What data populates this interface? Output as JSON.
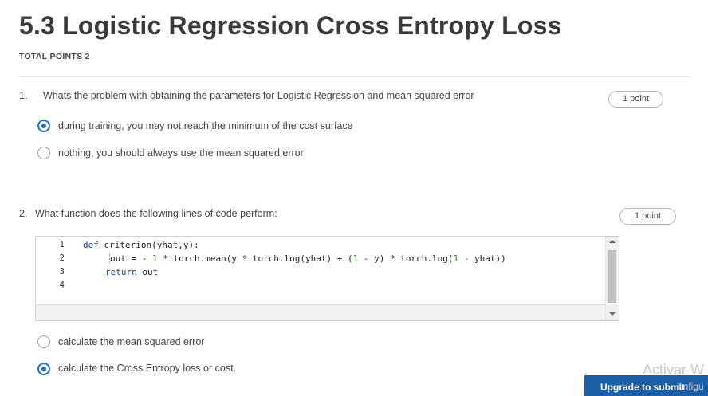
{
  "header": {
    "title": "5.3 Logistic Regression Cross Entropy Loss",
    "total_points": "TOTAL POINTS 2"
  },
  "questions": [
    {
      "number": "1.",
      "text": "Whats the problem with obtaining the parameters for Logistic Regression and mean squared error",
      "points": "1 point",
      "options": [
        {
          "label": "during training, you may not reach the minimum of the cost surface",
          "selected": true
        },
        {
          "label": "nothing, you should always use the mean squared error",
          "selected": false
        }
      ]
    },
    {
      "number": "2.",
      "text": "What function does the following lines of code perform:",
      "points": "1 point",
      "code": {
        "line_numbers": [
          "1",
          "2",
          "3",
          "4"
        ],
        "lines": [
          "def criterion(yhat,y):",
          "out = - 1 * torch.mean(y * torch.log(yhat) + (1 - y) * torch.log(1 - yhat))",
          "return out",
          ""
        ]
      },
      "options": [
        {
          "label": "calculate the mean squared error",
          "selected": false
        },
        {
          "label": "calculate the Cross Entropy loss or cost.",
          "selected": true
        }
      ]
    }
  ],
  "footer": {
    "upgrade_label": "Upgrade to submit",
    "watermark_line1": "Activar W",
    "watermark_line2": "onfigu"
  },
  "colors": {
    "accent": "#1a73c9",
    "button": "#1b5fa8"
  }
}
